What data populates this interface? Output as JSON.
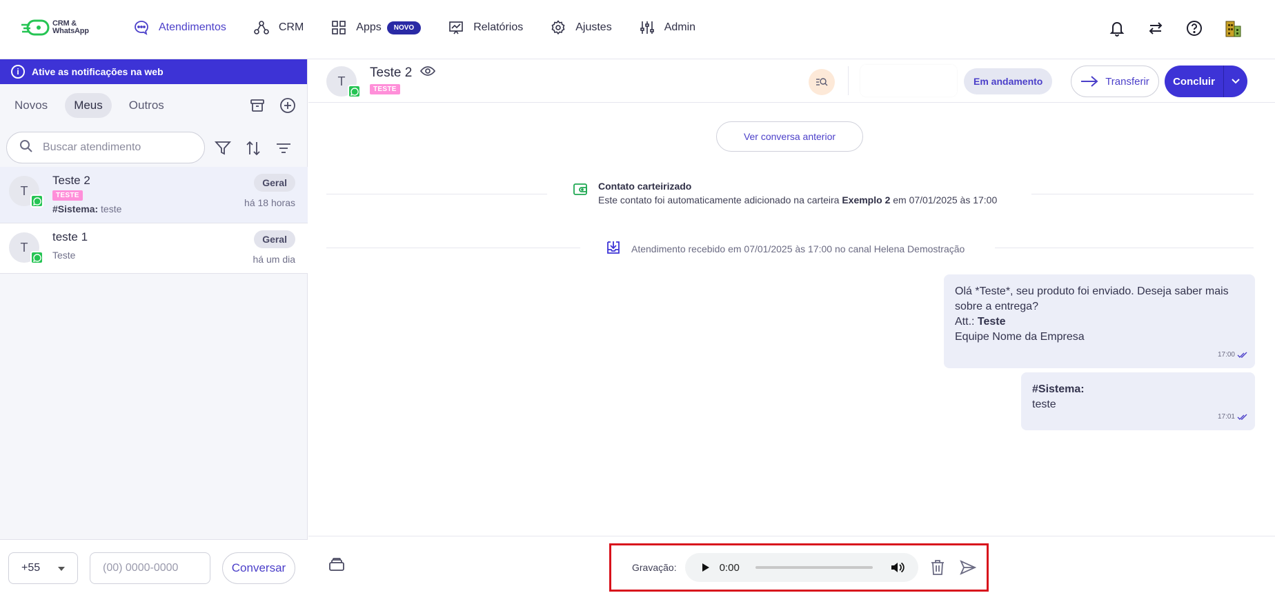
{
  "logo": {
    "line1": "CRM &",
    "line2": "WhatsApp"
  },
  "nav": [
    {
      "label": "Atendimentos",
      "icon": "chat-bubble-icon",
      "active": true
    },
    {
      "label": "CRM",
      "icon": "crm-nodes-icon"
    },
    {
      "label": "Apps",
      "icon": "apps-grid-icon",
      "badge": "NOVO"
    },
    {
      "label": "Relatórios",
      "icon": "report-chart-icon"
    },
    {
      "label": "Ajustes",
      "icon": "gear-icon"
    },
    {
      "label": "Admin",
      "icon": "sliders-icon"
    }
  ],
  "topbar_icons": [
    "bell-icon",
    "swap-arrows-icon",
    "help-icon",
    "building-icon"
  ],
  "notification_bar": {
    "text": "Ative as notificações na web"
  },
  "tabs": {
    "novos": "Novos",
    "meus": "Meus",
    "outros": "Outros",
    "active": "Meus"
  },
  "search": {
    "placeholder": "Buscar atendimento"
  },
  "conversations": [
    {
      "avatar": "T",
      "name": "Teste 2",
      "tag": "TESTE",
      "preview_prefix": "#Sistema:",
      "preview": " teste",
      "queue": "Geral",
      "time": "há 18 horas",
      "selected": true
    },
    {
      "avatar": "T",
      "name": "teste 1",
      "preview": "Teste",
      "queue": "Geral",
      "time": "há um dia"
    }
  ],
  "new_chat": {
    "ddi": "+55",
    "phone_placeholder": "(00) 0000-0000",
    "button": "Conversar"
  },
  "chat": {
    "avatar": "T",
    "name": "Teste 2",
    "tag": "TESTE",
    "status": "Em andamento",
    "transfer": "Transferir",
    "conclude": "Concluir",
    "prev_button": "Ver conversa anterior",
    "sys_carteira": {
      "title": "Contato carteirizado",
      "text_a": "Este contato foi automaticamente adicionado na carteira ",
      "bold": "Exemplo 2",
      "text_b": " em 07/01/2025 às 17:00"
    },
    "sys_received": "Atendimento recebido em 07/01/2025 às 17:00 no canal Helena Demostração",
    "messages": [
      {
        "line1": "Olá *Teste*, seu produto foi enviado. Deseja saber mais sobre a entrega?",
        "att_label": "Att.: ",
        "att_name": "Teste",
        "line3": "Equipe Nome da Empresa",
        "time": "17:00"
      },
      {
        "title": "#Sistema:",
        "body": "teste",
        "time": "17:01"
      }
    ]
  },
  "recorder": {
    "label": "Gravação:",
    "time": "0:00",
    "progress": 0
  },
  "colors": {
    "primary": "#3d33d6",
    "whatsapp": "#25c453",
    "tag_pink": "#ff8fd9",
    "highlight": "#d8121c"
  }
}
